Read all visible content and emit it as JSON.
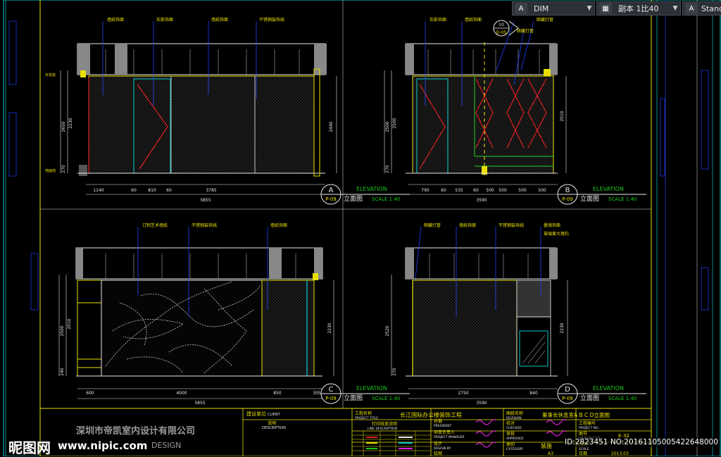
{
  "toolbar": {
    "dimstyle_value": "DIM",
    "scale_value": "副本 1比40",
    "textstyle_value": "Standa"
  },
  "sheet": {
    "elevations": [
      {
        "letter": "A",
        "sheet": "P-09",
        "title_cn": "立面图",
        "title_en": "ELEVATION",
        "scale": "SCALE 1:40",
        "notes": [
          "墙纸饰面",
          "灰影饰面",
          "墙纸饰面",
          "不锈钢装饰线"
        ],
        "dims_bottom": [
          "1140",
          "60",
          "810",
          "60",
          "3785"
        ],
        "dim_total": "5855",
        "dims_left": [
          "2650",
          "2230",
          "270"
        ],
        "dim_right": "2440",
        "levels": [
          "天花底",
          "地面线"
        ]
      },
      {
        "letter": "B",
        "sheet": "P-09",
        "title_cn": "立面图",
        "title_en": "ELEVATION",
        "scale": "SCALE 1:40",
        "notes": [
          "灰影饰面",
          "墙纸饰面",
          "暗藏灯管",
          "暗藏灯管"
        ],
        "callout_num": "10",
        "callout_sheet": "D-05",
        "dims_bottom": [
          "790",
          "60",
          "535",
          "60",
          "500",
          "500",
          "500",
          "500"
        ],
        "dim_total": "3590",
        "dims_left": [
          "2500",
          "2500",
          "270"
        ],
        "dim_right": "2010"
      },
      {
        "letter": "C",
        "sheet": "P-09",
        "title_cn": "立面图",
        "title_en": "ELEVATION",
        "scale": "SCALE 1:40",
        "notes": [
          "订制艺术墙纸",
          "不锈钢装饰线",
          "墙纸饰面"
        ],
        "dims_bottom": [
          "600",
          "4000",
          "850",
          "305"
        ],
        "dim_total": "5855",
        "dims_left": [
          "2500",
          "2010",
          "240"
        ],
        "dim_right": "2230"
      },
      {
        "letter": "D",
        "sheet": "P-09",
        "title_cn": "立面图",
        "title_en": "ELEVATION",
        "scale": "SCALE 1:40",
        "notes": [
          "暗藏灯管",
          "墙纸饰面",
          "不锈钢装饰线",
          "墨镜饰面",
          "玻璃黄大理石"
        ],
        "dims_bottom": [
          "2750",
          "840"
        ],
        "dim_total": "3590",
        "dims_left": [
          "2520",
          "270"
        ],
        "dim_right": "2230"
      }
    ],
    "title_block": {
      "client_cn": "建设单位",
      "client_en": "CLIENT",
      "desc_cn": "说明",
      "desc_en": "DESCRIPTION",
      "project_cn": "工程名称",
      "project_en": "PROJECT TITLE",
      "project_name": "长江国际办公楼装饰工程",
      "line_cn": "打印线宽说明",
      "line_en": "LINE DESCRIPTION",
      "president_cn": "总裁",
      "president_en": "PRESIDENT",
      "pm_cn": "项目负责人",
      "pm_en": "PROJECT MANAGER",
      "design_cn": "设计",
      "design_en": "DESIGN BY",
      "drawn_cn": "绘图",
      "drawing_cn": "图纸名称",
      "drawing_en": "REVISION",
      "drawing_name": "董事长休息室A B C D立面图",
      "checked_cn": "校对",
      "checked_en": "CHECKED",
      "approved_cn": "审核",
      "approved_en": "APPROVED",
      "category_cn": "类别",
      "category_en": "CATEGORY",
      "category_val": "装施",
      "project_no_cn": "工程编号",
      "project_no_en": "PROJECT NO.",
      "drawing_no_cn": "图号",
      "drawing_no_en": "DRAWING NO.",
      "drawing_no": "E-32",
      "scale_cn": "比例",
      "scale_en": "SCALE",
      "date_cn": "日期",
      "date_val": "2013.03",
      "size_val": "A3",
      "company": "深圳市帝凯室内设计有限公司",
      "company_en": "DESIGN"
    }
  },
  "watermark": {
    "logo": "昵图网",
    "url": "www.nipic.com",
    "id_text": "ID:2823451 NO:20161105005422648000"
  },
  "colors": {
    "yellow": "#e8e000",
    "cyan": "#00c8c8",
    "red": "#e02020",
    "green": "#18c818",
    "blue": "#2040ff",
    "white": "#e8e8e8",
    "magenta": "#e020e0"
  }
}
